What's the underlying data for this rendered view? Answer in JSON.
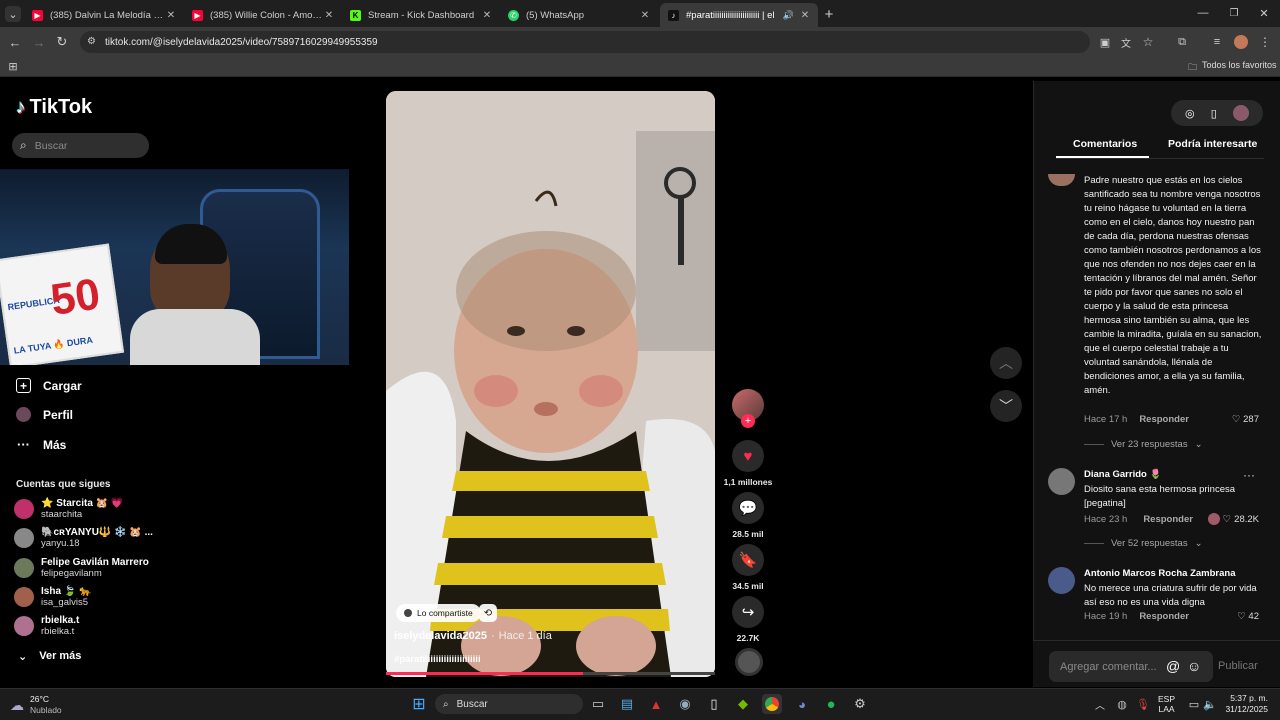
{
  "browser": {
    "tabs": [
      {
        "label": "(385) Dalvin La Melodía | Ensam",
        "icon_color": "#ff0033",
        "icon": "youtube-icon"
      },
      {
        "label": "(385) Willie Colon - Amor Verd",
        "icon_color": "#ff0033",
        "icon": "youtube-icon"
      },
      {
        "label": "Stream - Kick Dashboard",
        "icon_color": "#53fc18",
        "icon": "kick-icon"
      },
      {
        "label": "(5) WhatsApp",
        "icon_color": "#25d366",
        "icon": "whatsapp-icon"
      },
      {
        "label": "#paratiiiiiiiiiiiiiiiiiiiiii | el",
        "icon_color": "#ffffff",
        "icon": "tiktok-icon"
      }
    ],
    "url": "tiktok.com/@iselydelavida2025/video/7589716029949955359",
    "bookmarks_label": "Todos los favoritos"
  },
  "tiktok": {
    "logo": "TikTok",
    "search_placeholder": "Buscar",
    "nav": [
      {
        "label": "Cargar",
        "icon": "upload-icon"
      },
      {
        "label": "Perfil",
        "icon": "profile-icon"
      },
      {
        "label": "Más",
        "icon": "more-icon"
      }
    ],
    "following_title": "Cuentas que sigues",
    "accounts": [
      {
        "name": "⭐ Starcita 🐹 💗",
        "handle": "staarchita",
        "color": "#c0306a"
      },
      {
        "name": "🐘ᴄʀYANYU🔱 ❄️ 🐹 ...",
        "handle": "yanyu.18",
        "color": "#888888"
      },
      {
        "name": "Felipe Gavilán Marrero",
        "handle": "felipegavilanm",
        "color": "#6a7a5a"
      },
      {
        "name": "Isha 🍃 🐆",
        "handle": "isa_galvis5",
        "color": "#a0604a"
      },
      {
        "name": "rbielka.t",
        "handle": "rbielka.t",
        "color": "#b07090"
      }
    ],
    "ver_mas": "Ver más",
    "webcam_sign": {
      "top": "REPUBLICA",
      "number": "50",
      "bottom": "LA TUYA 🔥 DURA"
    }
  },
  "video": {
    "share_chip": "Lo compartiste",
    "author": "iselydelavida2025",
    "time": "Hace 1 día",
    "caption": "#paratiiiiiiiiiiiiiiiiiiiiii",
    "progress": 0.6,
    "likes": "1,1 millones",
    "comments": "28.5 mil",
    "saves": "34.5 mil",
    "shares": "22.7K"
  },
  "comments_panel": {
    "tabs": [
      "Comentarios",
      "Podría interesarte"
    ],
    "comments": [
      {
        "text": "Padre nuestro que estás en los cielos santificado sea tu nombre venga nosotros tu reino hágase tu voluntad en la tierra como en el cielo, danos hoy nuestro pan de cada día, perdona nuestras ofensas como también nosotros perdonamos a los que nos ofenden no nos dejes caer en la tentación y líbranos del mal amén. Señor te pido por favor que sanes no solo el cuerpo y la salud de esta princesa hermosa sino también su alma, que les cambie la miradita, guíala en su sanacion, que el cuerpo celestial trabaje a tu voluntad sanándola, llénala de bendiciones amor, a ella ya su familia, amén.",
        "time": "Hace 17 h",
        "reply": "Responder",
        "likes": "287",
        "replies": "Ver 23 respuestas"
      },
      {
        "name": "Diana Garrido 🌷",
        "text": "Diosito sana esta hermosa princesa [pegatina]",
        "time": "Hace 23 h",
        "reply": "Responder",
        "likes": "28.2K",
        "replies": "Ver 52 respuestas"
      },
      {
        "name": "Antonio Marcos Rocha Zambrana",
        "text": "No merece una criatura sufrir de por vida así eso no es una vida digna",
        "time": "Hace 19 h",
        "reply": "Responder",
        "likes": "42"
      }
    ],
    "input_placeholder": "Agregar comentar...",
    "publish": "Publicar"
  },
  "taskbar": {
    "weather_temp": "26°C",
    "weather_desc": "Nublado",
    "search": "Buscar",
    "lang": "ESP",
    "lang2": "LAA",
    "time": "5:37 p. m.",
    "date": "31/12/2025"
  }
}
